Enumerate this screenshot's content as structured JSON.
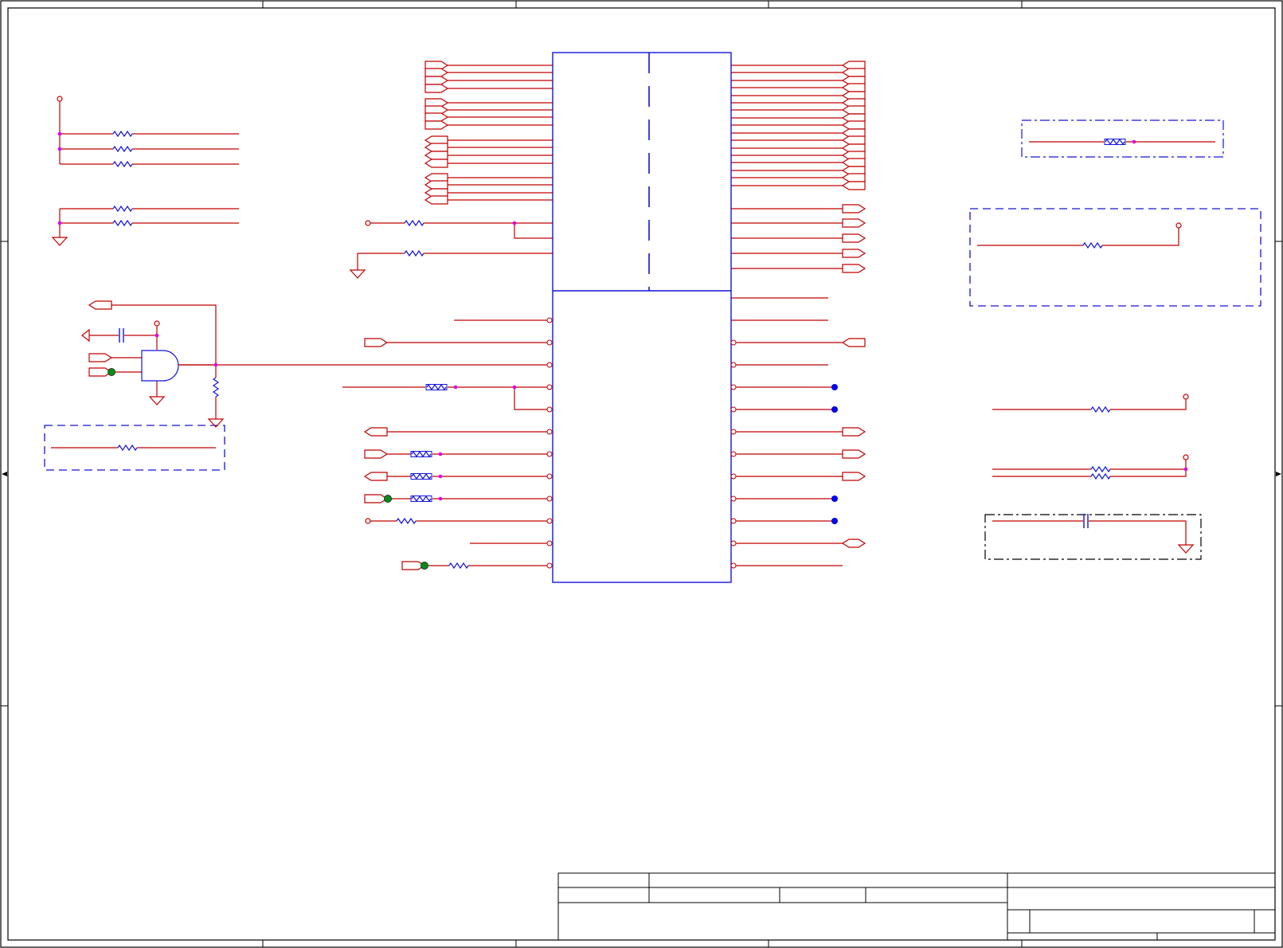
{
  "colors": {
    "background": "#ffffff",
    "frame": "#000000",
    "wire": "#c00000",
    "component": "#1414d8",
    "net_dot": "#e000e0",
    "pin_dot": "#0a8a1a",
    "no_connect": "#0000ee"
  },
  "title_block": {
    "present": true,
    "text": []
  },
  "symbols": {
    "resistor": "resistor-icon",
    "capacitor": "capacitor-icon",
    "and_gate": "and-gate-icon",
    "ground": "ground-icon",
    "power": "power-terminal-icon",
    "port": "net-port-icon",
    "ic": "ic-package-icon"
  }
}
